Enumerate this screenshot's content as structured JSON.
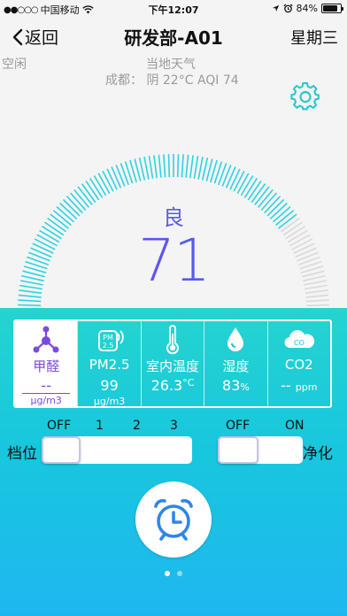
{
  "status_bar": {
    "carrier": "中国移动",
    "time": "下午12:07",
    "battery": "84%",
    "battery_level": 0.84
  },
  "nav": {
    "back_label": "返回",
    "title": "研发部-A01",
    "weekday": "星期三"
  },
  "info": {
    "status": "空闲",
    "weather_label": "当地天气",
    "weather_line": "成都： 阴 22°C AQI 74"
  },
  "gauge": {
    "grade": "良",
    "value": "71",
    "fraction": 0.71,
    "colors": {
      "active": "#2fd3e0",
      "inactive": "#d9d9d9"
    }
  },
  "metrics": [
    {
      "id": "formaldehyde",
      "name": "甲醛",
      "value": "--",
      "unit": "μg/m3"
    },
    {
      "id": "pm25",
      "name": "PM2.5",
      "value": "99",
      "unit": "μg/m3",
      "icon_text_top": "PM",
      "icon_text_bottom": "2.5"
    },
    {
      "id": "temperature",
      "name": "室内温度",
      "value": "26.3",
      "unit": "°C"
    },
    {
      "id": "humidity",
      "name": "湿度",
      "value": "83",
      "unit": "%"
    },
    {
      "id": "co2",
      "name": "CO2",
      "value": "--",
      "unit": "ppm",
      "icon_text": "CO"
    }
  ],
  "controls": {
    "speed_label": "档位",
    "speed_ticks": [
      "OFF",
      "1",
      "2",
      "3"
    ],
    "speed_level": 0,
    "purify_label": "净化",
    "purify_off": "OFF",
    "purify_on": "ON",
    "purify_state": "OFF"
  },
  "colors": {
    "accent_purple": "#7b4ae0",
    "accent_cyan": "#25d4cf",
    "accent_blue": "#1fb7f0"
  },
  "icons": {
    "back": "chevron-left-icon",
    "settings": "gear-icon",
    "alarm": "alarm-clock-icon"
  },
  "pager": {
    "pages": 2,
    "active": 0
  }
}
